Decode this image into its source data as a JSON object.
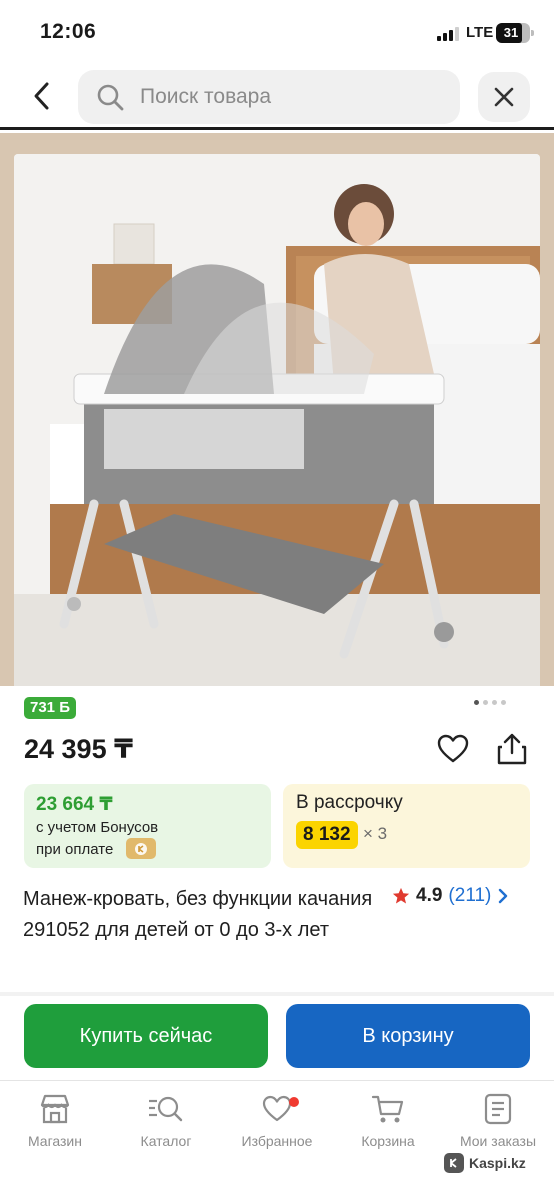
{
  "status_bar": {
    "time": "12:06",
    "network": "LTE",
    "battery": "31"
  },
  "header": {
    "back_icon": "chevron-left-icon",
    "search_placeholder": "Поиск товара",
    "search_icon": "search-icon",
    "clear_icon": "close-icon"
  },
  "gallery": {
    "image_count": 4,
    "active_index": 0
  },
  "product": {
    "bonus_badge": "731 Б",
    "price": "24 395 ₸",
    "bonus_card": {
      "amount": "23 664 ₸",
      "line1": "с учетом Бонусов",
      "line2": "при оплате"
    },
    "installment_card": {
      "title": "В рассрочку",
      "amount": "8 132",
      "multiplier": "× 3"
    },
    "title": "Манеж-кровать, без функции качания 291052 для детей от 0 до 3-х лет",
    "rating": {
      "value": "4.9",
      "count": "(211)"
    }
  },
  "actions": {
    "buy_now": "Купить сейчас",
    "add_to_cart": "В корзину"
  },
  "tabbar": {
    "items": [
      {
        "label": "Магазин",
        "icon": "shop-icon"
      },
      {
        "label": "Каталог",
        "icon": "catalog-search-icon"
      },
      {
        "label": "Избранное",
        "icon": "heart-icon"
      },
      {
        "label": "Корзина",
        "icon": "cart-icon"
      },
      {
        "label": "Мои заказы",
        "icon": "orders-icon"
      }
    ]
  },
  "watermark": "Kaspi.kz",
  "colors": {
    "green": "#1f9e3c",
    "blue": "#1766c2",
    "yellow": "#fbd400",
    "rating_blue": "#1f6fd1",
    "notification": "#f03a30"
  }
}
